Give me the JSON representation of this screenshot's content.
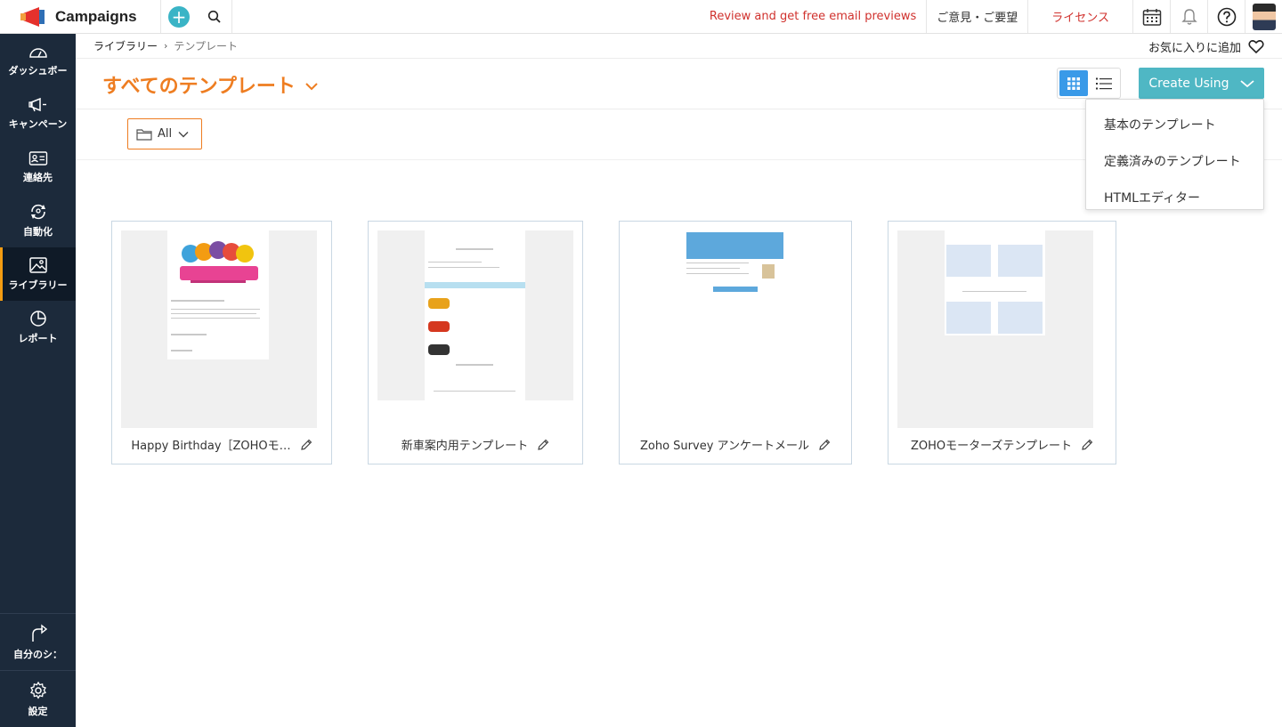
{
  "app": {
    "name": "Campaigns"
  },
  "topbar": {
    "review_link": "Review and get free email previews",
    "feedback_link": "ご意見・ご要望",
    "license_link": "ライセンス",
    "icons": [
      "add-icon",
      "search-icon",
      "calendar-icon",
      "bell-icon",
      "help-icon",
      "user-avatar"
    ]
  },
  "sidebar": {
    "items": [
      {
        "label": "ダッシュボー",
        "icon": "dashboard-icon"
      },
      {
        "label": "キャンペーン",
        "icon": "megaphone-icon"
      },
      {
        "label": "連絡先",
        "icon": "contact-card-icon"
      },
      {
        "label": "自動化",
        "icon": "automation-icon"
      },
      {
        "label": "ライブラリー",
        "icon": "image-library-icon",
        "active": true
      },
      {
        "label": "レポート",
        "icon": "pie-chart-icon"
      }
    ],
    "bottom": [
      {
        "label": "自分のシ：",
        "icon": "share-icon"
      },
      {
        "label": "設定",
        "icon": "gear-icon"
      }
    ]
  },
  "breadcrumb": {
    "root": "ライブラリー",
    "current": "テンプレート"
  },
  "favorite": {
    "label": "お気に入りに追加"
  },
  "page": {
    "title": "すべてのテンプレート"
  },
  "filter": {
    "folder_value": "All"
  },
  "create": {
    "label": "Create Using",
    "options": [
      "基本のテンプレート",
      "定義済みのテンプレート",
      "HTMLエディター"
    ]
  },
  "templates": [
    {
      "name": "Happy Birthday［ZOHOモ…"
    },
    {
      "name": "新車案内用テンプレート"
    },
    {
      "name": "Zoho Survey アンケートメール"
    },
    {
      "name": "ZOHOモーターズテンプレート"
    }
  ],
  "colors": {
    "accent": "#ee7d21",
    "sidebar": "#1c2a3b",
    "create_button": "#4fb7c4",
    "active_view": "#3a9ae8",
    "alert_red": "#d0312d"
  }
}
